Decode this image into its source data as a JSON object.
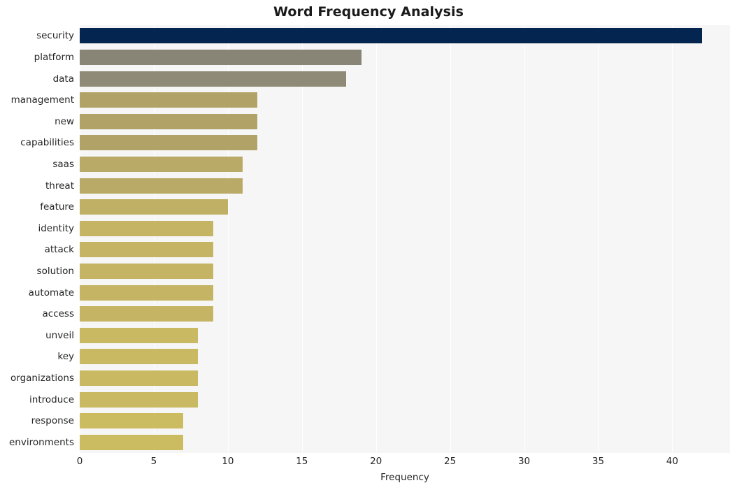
{
  "chart_data": {
    "type": "bar",
    "orientation": "horizontal",
    "title": "Word Frequency Analysis",
    "xlabel": "Frequency",
    "ylabel": "",
    "xlim": [
      0,
      43.9
    ],
    "xticks": [
      0,
      5,
      10,
      15,
      20,
      25,
      30,
      35,
      40
    ],
    "xtick_labels": [
      "0",
      "5",
      "10",
      "15",
      "20",
      "25",
      "30",
      "35",
      "40"
    ],
    "grid": true,
    "grid_axis": "x",
    "legend": "none",
    "categories": [
      "security",
      "platform",
      "data",
      "management",
      "new",
      "capabilities",
      "saas",
      "threat",
      "feature",
      "identity",
      "attack",
      "solution",
      "automate",
      "access",
      "unveil",
      "key",
      "organizations",
      "introduce",
      "response",
      "environments"
    ],
    "values": [
      42,
      19,
      18,
      12,
      12,
      12,
      11,
      11,
      10,
      9,
      9,
      9,
      9,
      9,
      8,
      8,
      8,
      8,
      7,
      7
    ],
    "bar_colors": [
      "#04254f",
      "#888577",
      "#8e8a77",
      "#b1a368",
      "#b1a368",
      "#b1a368",
      "#b9ab67",
      "#b9ab67",
      "#bfb065",
      "#c4b463",
      "#c4b463",
      "#c4b463",
      "#c4b463",
      "#c4b463",
      "#c9b962",
      "#c9b962",
      "#c9b962",
      "#c9b962",
      "#ccbc61",
      "#ccbc61"
    ]
  },
  "style": {
    "plot_background": "#f6f6f6",
    "figure_background": "#ffffff",
    "gridline_color": "#ffffff",
    "text_color": "#262626",
    "title_color": "#1a1a1a"
  }
}
